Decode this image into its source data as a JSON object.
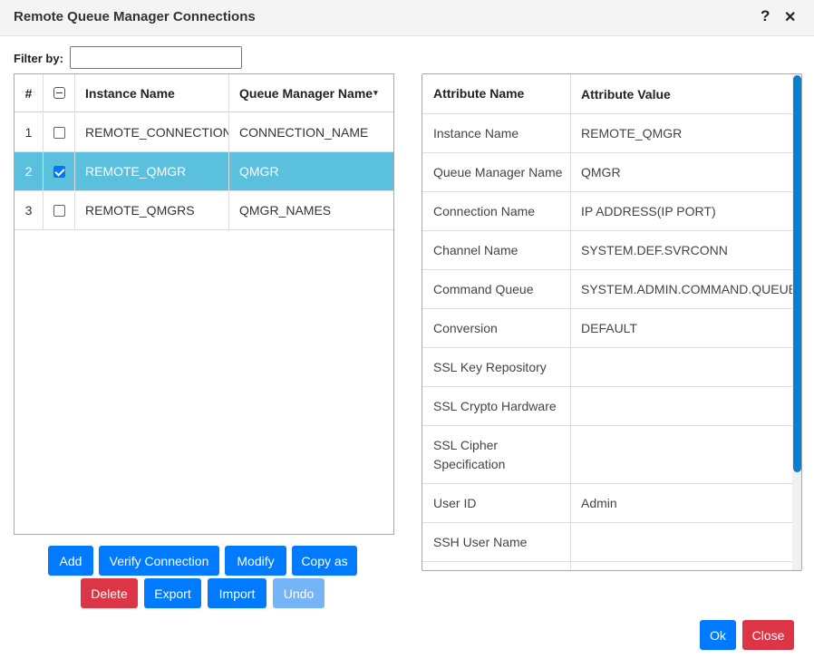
{
  "dialog": {
    "title": "Remote Queue Manager Connections",
    "help_glyph": "?",
    "close_glyph": "✕"
  },
  "filter": {
    "label": "Filter by:",
    "value": "",
    "placeholder": ""
  },
  "left_table": {
    "columns": {
      "num": "#",
      "instance": "Instance Name",
      "queue_manager": "Queue Manager Name",
      "sort_glyph": "▾"
    },
    "rows": [
      {
        "num": "1",
        "instance": "REMOTE_CONNECTION",
        "queue_manager": "CONNECTION_NAME",
        "checked": false,
        "selected": false
      },
      {
        "num": "2",
        "instance": "REMOTE_QMGR",
        "queue_manager": "QMGR",
        "checked": true,
        "selected": true
      },
      {
        "num": "3",
        "instance": "REMOTE_QMGRS",
        "queue_manager": "QMGR_NAMES",
        "checked": false,
        "selected": false
      }
    ]
  },
  "buttons": {
    "add": "Add",
    "verify": "Verify Connection",
    "modify": "Modify",
    "copy_as": "Copy as",
    "delete": "Delete",
    "export": "Export",
    "import": "Import",
    "undo": "Undo",
    "ok": "Ok",
    "close": "Close"
  },
  "attributes": {
    "header": {
      "name": "Attribute Name",
      "value": "Attribute Value"
    },
    "rows": [
      {
        "name": "Instance Name",
        "value": "REMOTE_QMGR"
      },
      {
        "name": "Queue Manager Name",
        "value": "QMGR"
      },
      {
        "name": "Connection Name",
        "value": "IP ADDRESS(IP PORT)"
      },
      {
        "name": "Channel Name",
        "value": "SYSTEM.DEF.SVRCONN"
      },
      {
        "name": "Command Queue",
        "value": "SYSTEM.ADMIN.COMMAND.QUEUE"
      },
      {
        "name": "Conversion",
        "value": "DEFAULT"
      },
      {
        "name": "SSL Key Repository",
        "value": ""
      },
      {
        "name": "SSL Crypto Hardware",
        "value": ""
      },
      {
        "name": "SSL Cipher Specification",
        "value": ""
      },
      {
        "name": "User ID",
        "value": "Admin"
      },
      {
        "name": "SSH User Name",
        "value": ""
      }
    ]
  },
  "colors": {
    "selected_row": "#5bc0de",
    "primary": "#007bff",
    "danger": "#dc3545",
    "scrollbar": "#0a7fd0"
  }
}
